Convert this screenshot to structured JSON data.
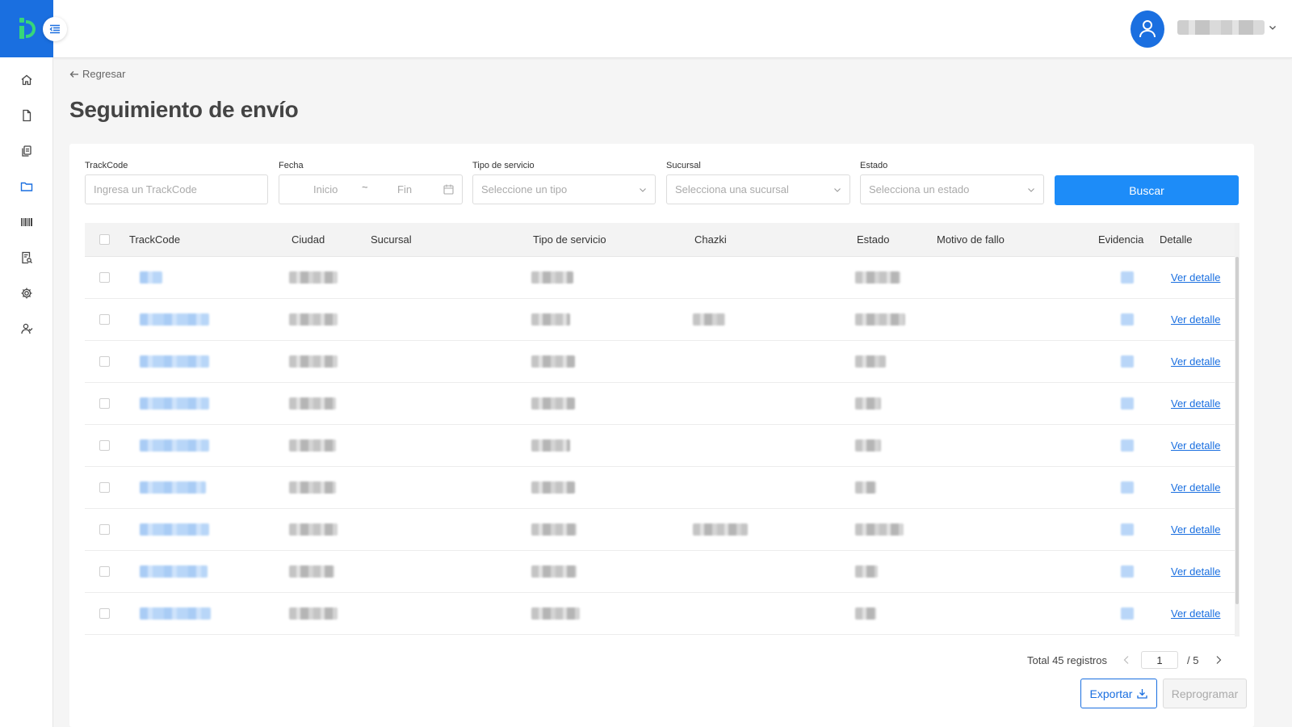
{
  "header": {
    "back_label": "Regresar",
    "page_title": "Seguimiento de envío"
  },
  "sidebar": {
    "items": [
      {
        "icon": "home-icon"
      },
      {
        "icon": "document-icon"
      },
      {
        "icon": "copy-documents-icon"
      },
      {
        "icon": "folder-icon",
        "active": true
      },
      {
        "icon": "barcode-icon"
      },
      {
        "icon": "report-search-icon"
      },
      {
        "icon": "gear-icon"
      },
      {
        "icon": "users-icon"
      }
    ]
  },
  "filters": {
    "trackcode": {
      "label": "TrackCode",
      "placeholder": "Ingresa un TrackCode"
    },
    "fecha": {
      "label": "Fecha",
      "start_placeholder": "Inicio",
      "separator": "~",
      "end_placeholder": "Fin"
    },
    "tipo_servicio": {
      "label": "Tipo de servicio",
      "placeholder": "Seleccione un tipo"
    },
    "sucursal": {
      "label": "Sucursal",
      "placeholder": "Selecciona una sucursal"
    },
    "estado": {
      "label": "Estado",
      "placeholder": "Selecciona un estado"
    },
    "search_label": "Buscar"
  },
  "table": {
    "columns": [
      "TrackCode",
      "Ciudad",
      "Sucursal",
      "Tipo de servicio",
      "Chazki",
      "Estado",
      "Motivo de fallo",
      "Evidencia",
      "Detalle"
    ],
    "detail_link_label": "Ver detalle",
    "row_count": 9
  },
  "pagination": {
    "total_label": "Total 45 registros",
    "current_page": "1",
    "of_label": "/ 5"
  },
  "actions": {
    "export_label": "Exportar",
    "reschedule_label": "Reprogramar"
  },
  "colors": {
    "primary": "#1a6fe0",
    "search_button": "#1d8cf8",
    "logo_green": "#37d67a"
  }
}
